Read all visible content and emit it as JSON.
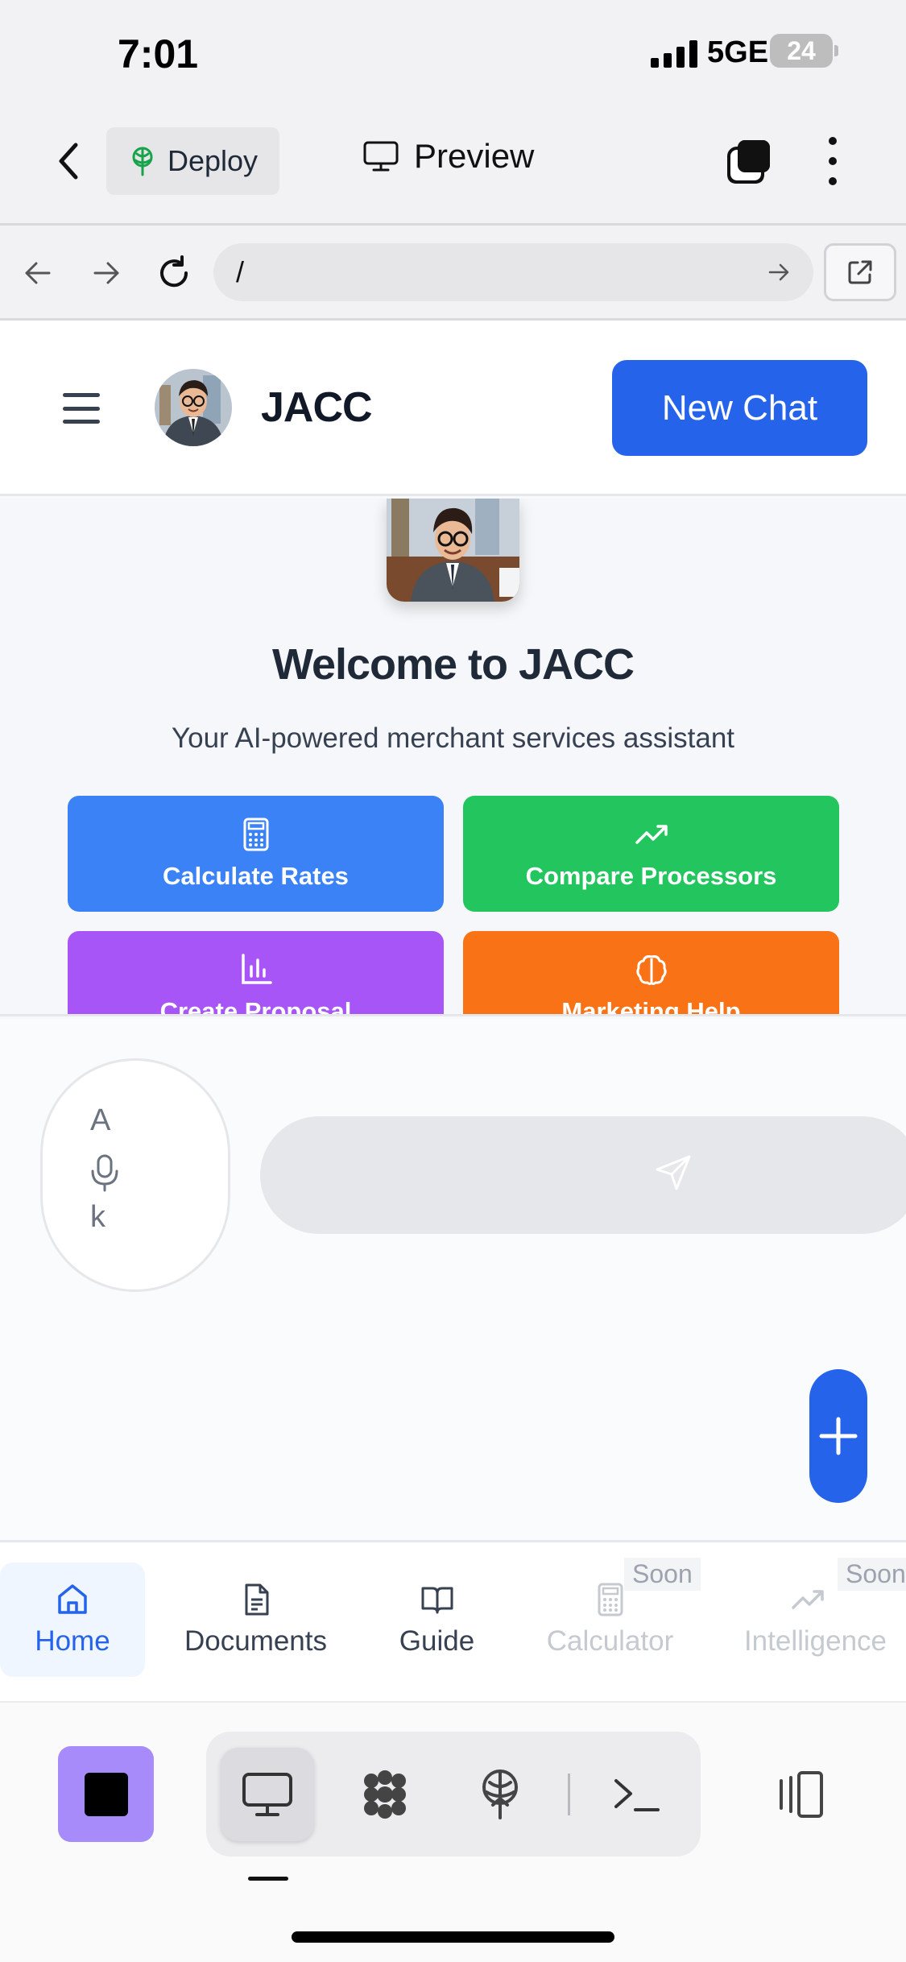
{
  "status_bar": {
    "time": "7:01",
    "network": "5GE",
    "battery": "24"
  },
  "topbar": {
    "deploy_label": "Deploy",
    "preview_label": "Preview"
  },
  "urlbar": {
    "url": "/"
  },
  "app_header": {
    "brand": "JACC",
    "new_chat_label": "New Chat"
  },
  "welcome": {
    "title": "Welcome to JACC",
    "subtitle": "Your AI-powered merchant services assistant",
    "actions": [
      {
        "label": "Calculate Rates",
        "icon": "calculator-icon",
        "color": "#3b82f6"
      },
      {
        "label": "Compare Processors",
        "icon": "trending-up-icon",
        "color": "#22c55e"
      },
      {
        "label": "Create Proposal",
        "icon": "bar-chart-icon",
        "color": "#a855f7"
      },
      {
        "label": "Marketing Help",
        "icon": "brain-icon",
        "color": "#f97316"
      }
    ]
  },
  "input": {
    "mic_text_top": "A",
    "mic_text_bottom": "k"
  },
  "bottom_nav": {
    "items": [
      {
        "label": "Home",
        "icon": "home-icon",
        "active": true
      },
      {
        "label": "Documents",
        "icon": "document-icon"
      },
      {
        "label": "Guide",
        "icon": "book-icon"
      },
      {
        "label": "Calculator",
        "icon": "calculator-icon",
        "badge": "Soon",
        "disabled": true
      },
      {
        "label": "Intelligence",
        "icon": "trending-up-icon",
        "badge": "Soon",
        "disabled": true
      }
    ]
  },
  "colors": {
    "primary": "#2563eb",
    "stop_button": "#a78bfa",
    "active_nav_bg": "#eff6ff"
  }
}
